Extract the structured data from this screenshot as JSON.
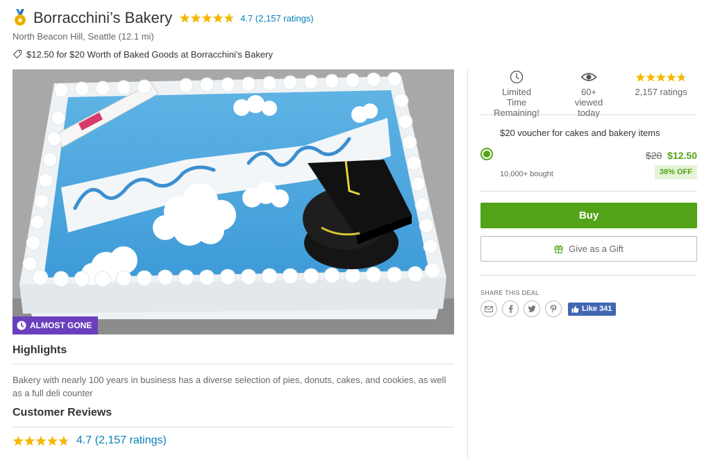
{
  "header": {
    "title": "Borracchini’s Bakery",
    "rating_text": "4.7 (2,157 ratings)",
    "location": "North Beacon Hill, Seattle (12.1 mi)",
    "deal_line": "$12.50 for $20 Worth of Baked Goods at Borracchini's Bakery"
  },
  "rating": {
    "value": 4.7,
    "max": 5
  },
  "photo": {
    "badge_label": "ALMOST GONE"
  },
  "highlights": {
    "heading": "Highlights",
    "text": "Bakery with nearly 100 years in business has a diverse selection of pies, donuts, cakes, and cookies, as well as a full deli counter"
  },
  "reviews": {
    "heading": "Customer Reviews",
    "rating_text": "4.7 (2,157 ratings)"
  },
  "stats": {
    "time_label": "Limited Time Remaining!",
    "viewed_label": "60+ viewed today",
    "ratings_label": "2,157 ratings"
  },
  "voucher": {
    "title": "$20 voucher for cakes and bakery items",
    "original_price": "$20",
    "sale_price": "$12.50",
    "bought": "10,000+ bought",
    "discount": "38% OFF",
    "selected": true
  },
  "actions": {
    "buy_label": "Buy",
    "gift_label": "Give as a Gift"
  },
  "share": {
    "label": "SHARE THIS DEAL",
    "like_label": "Like 341"
  },
  "colors": {
    "accent_green": "#53a318",
    "link_blue": "#0981b8",
    "star_gold": "#f5b800",
    "badge_purple": "#6a3fbd",
    "facebook_blue": "#4267b2"
  },
  "icons": [
    "medal-icon",
    "star-icon",
    "tag-icon",
    "clock-icon",
    "eye-icon",
    "gift-icon",
    "mail-icon",
    "facebook-icon",
    "twitter-icon",
    "pinterest-icon",
    "thumbs-up-icon"
  ]
}
